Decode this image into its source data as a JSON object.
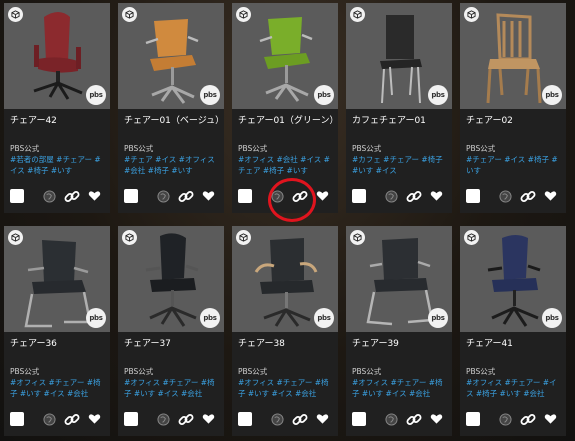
{
  "cards": [
    {
      "title": "チェアー42",
      "author": "PBS公式",
      "tags": "#若者の部屋 #チェアー #イス #椅子 #いす",
      "pbs": "pbs"
    },
    {
      "title": "チェアー01（ベージュ）",
      "author": "PBS公式",
      "tags": "#チェア #イス #オフィス #会社 #椅子 #いす",
      "pbs": "pbs"
    },
    {
      "title": "チェアー01（グリーン）",
      "author": "PBS公式",
      "tags": "#オフィス #会社 #イス #チェア #椅子 #いす",
      "pbs": "pbs"
    },
    {
      "title": "カフェチェアー01",
      "author": "PBS公式",
      "tags": "#カフェ #チェアー #椅子 #いす #イス",
      "pbs": "pbs"
    },
    {
      "title": "チェアー02",
      "author": "PBS公式",
      "tags": "#チェアー #イス #椅子 #いす",
      "pbs": "pbs"
    },
    {
      "title": "チェアー36",
      "author": "PBS公式",
      "tags": "#オフィス #チェアー #椅子 #いす #イス #会社",
      "pbs": "pbs"
    },
    {
      "title": "チェアー37",
      "author": "PBS公式",
      "tags": "#オフィス #チェアー #椅子 #いす #イス #会社",
      "pbs": "pbs"
    },
    {
      "title": "チェアー38",
      "author": "PBS公式",
      "tags": "#オフィス #チェアー #椅子 #いす #イス #会社",
      "pbs": "pbs"
    },
    {
      "title": "チェアー39",
      "author": "PBS公式",
      "tags": "#オフィス #チェアー #椅子 #いす #イス #会社",
      "pbs": "pbs"
    },
    {
      "title": "チェアー41",
      "author": "PBS公式",
      "tags": "#オフィス #チェアー #イス #椅子 #いす #会社",
      "pbs": "pbs"
    }
  ],
  "colors": {
    "tag": "#3aa0e0",
    "highlight": "#e0141e",
    "thumb_bg": "#5b5b5b",
    "card_bg": "#202020"
  },
  "icons": [
    "cube-icon",
    "pbs-badge",
    "checkbox",
    "globe-icon",
    "link-icon",
    "heart-icon"
  ]
}
